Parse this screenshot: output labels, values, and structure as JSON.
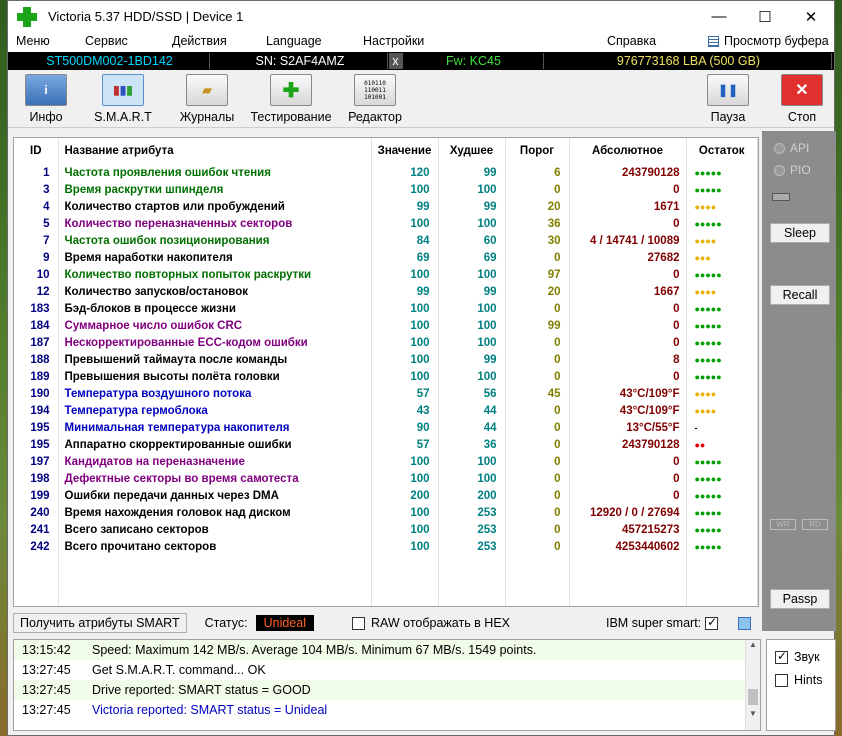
{
  "window": {
    "title": "Victoria 5.37 HDD/SSD | Device 1",
    "minimize": "—",
    "maximize": "☐",
    "close": "✕"
  },
  "menu": {
    "items": [
      "Меню",
      "Сервис",
      "Действия",
      "Language",
      "Настройки",
      "Справка"
    ],
    "buffer": "Просмотр буфера"
  },
  "info": {
    "model": "ST500DM002-1BD142",
    "sn": "SN: S2AF4AMZ",
    "x": "x",
    "fw": "Fw: KC45",
    "lba": "976773168 LBA (500 GB)"
  },
  "toolbar": {
    "info": "Инфо",
    "smart": "S.M.A.R.T",
    "logs": "Журналы",
    "test": "Тестирование",
    "editor": "Редактор",
    "pause": "Пауза",
    "stop": "Стоп"
  },
  "table": {
    "headers": {
      "id": "ID",
      "name": "Название атрибута",
      "value": "Значение",
      "worst": "Худшее",
      "threshold": "Порог",
      "absolute": "Абсолютное",
      "remaining": "Остаток"
    },
    "rows": [
      {
        "id": "1",
        "name": "Частота проявления ошибок чтения",
        "value": "120",
        "worst": "99",
        "thr": "6",
        "abs": "243790128",
        "rem": "●●●●●",
        "nc": "#007000",
        "rc": "#00a000"
      },
      {
        "id": "3",
        "name": "Время раскрутки шпинделя",
        "value": "100",
        "worst": "100",
        "thr": "0",
        "abs": "0",
        "rem": "●●●●●",
        "nc": "#007000",
        "rc": "#00a000"
      },
      {
        "id": "4",
        "name": "Количество стартов или пробуждений",
        "value": "99",
        "worst": "99",
        "thr": "20",
        "abs": "1671",
        "rem": "●●●●",
        "nc": "#000000",
        "rc": "#e8b000"
      },
      {
        "id": "5",
        "name": "Количество переназначенных секторов",
        "value": "100",
        "worst": "100",
        "thr": "36",
        "abs": "0",
        "rem": "●●●●●",
        "nc": "#800080",
        "rc": "#00a000"
      },
      {
        "id": "7",
        "name": "Частота ошибок позиционирования",
        "value": "84",
        "worst": "60",
        "thr": "30",
        "abs": "4 / 14741 / 10089",
        "rem": "●●●●",
        "nc": "#007000",
        "rc": "#e8b000"
      },
      {
        "id": "9",
        "name": "Время наработки накопителя",
        "value": "69",
        "worst": "69",
        "thr": "0",
        "abs": "27682",
        "rem": "●●●",
        "nc": "#000000",
        "rc": "#e8b000"
      },
      {
        "id": "10",
        "name": "Количество повторных попыток раскрутки",
        "value": "100",
        "worst": "100",
        "thr": "97",
        "abs": "0",
        "rem": "●●●●●",
        "nc": "#007000",
        "rc": "#00a000"
      },
      {
        "id": "12",
        "name": "Количество запусков/остановок",
        "value": "99",
        "worst": "99",
        "thr": "20",
        "abs": "1667",
        "rem": "●●●●",
        "nc": "#000000",
        "rc": "#e8b000"
      },
      {
        "id": "183",
        "name": "Бэд-блоков в процессе жизни",
        "value": "100",
        "worst": "100",
        "thr": "0",
        "abs": "0",
        "rem": "●●●●●",
        "nc": "#000000",
        "rc": "#00a000"
      },
      {
        "id": "184",
        "name": "Суммарное число ошибок CRC",
        "value": "100",
        "worst": "100",
        "thr": "99",
        "abs": "0",
        "rem": "●●●●●",
        "nc": "#800080",
        "rc": "#00a000"
      },
      {
        "id": "187",
        "name": "Нескорректированные ECC-кодом ошибки",
        "value": "100",
        "worst": "100",
        "thr": "0",
        "abs": "0",
        "rem": "●●●●●",
        "nc": "#800080",
        "rc": "#00a000"
      },
      {
        "id": "188",
        "name": "Превышений таймаута после команды",
        "value": "100",
        "worst": "99",
        "thr": "0",
        "abs": "8",
        "rem": "●●●●●",
        "nc": "#000000",
        "rc": "#00a000"
      },
      {
        "id": "189",
        "name": "Превышения высоты полёта головки",
        "value": "100",
        "worst": "100",
        "thr": "0",
        "abs": "0",
        "rem": "●●●●●",
        "nc": "#000000",
        "rc": "#00a000"
      },
      {
        "id": "190",
        "name": "Температура воздушного потока",
        "value": "57",
        "worst": "56",
        "thr": "45",
        "abs": "43°C/109°F",
        "rem": "●●●●",
        "nc": "#0000c0",
        "rc": "#e8b000"
      },
      {
        "id": "194",
        "name": "Температура гермоблока",
        "value": "43",
        "worst": "44",
        "thr": "0",
        "abs": "43°C/109°F",
        "rem": "●●●●",
        "nc": "#0000c0",
        "rc": "#e8b000"
      },
      {
        "id": "195",
        "name": "Минимальная температура накопителя",
        "value": "90",
        "worst": "44",
        "thr": "0",
        "abs": "13°C/55°F",
        "rem": "-",
        "nc": "#0000c0",
        "rc": "#000000"
      },
      {
        "id": "195",
        "name": "Аппаратно скорректированные ошибки",
        "value": "57",
        "worst": "36",
        "thr": "0",
        "abs": "243790128",
        "rem": "●●",
        "nc": "#000000",
        "rc": "#e00000"
      },
      {
        "id": "197",
        "name": "Кандидатов на переназначение",
        "value": "100",
        "worst": "100",
        "thr": "0",
        "abs": "0",
        "rem": "●●●●●",
        "nc": "#800080",
        "rc": "#00a000"
      },
      {
        "id": "198",
        "name": "Дефектные секторы во время самотеста",
        "value": "100",
        "worst": "100",
        "thr": "0",
        "abs": "0",
        "rem": "●●●●●",
        "nc": "#800080",
        "rc": "#00a000"
      },
      {
        "id": "199",
        "name": "Ошибки передачи данных через DMA",
        "value": "200",
        "worst": "200",
        "thr": "0",
        "abs": "0",
        "rem": "●●●●●",
        "nc": "#000000",
        "rc": "#00a000"
      },
      {
        "id": "240",
        "name": "Время нахождения головок над диском",
        "value": "100",
        "worst": "253",
        "thr": "0",
        "abs": "12920 / 0 / 27694",
        "rem": "●●●●●",
        "nc": "#000000",
        "rc": "#00a000"
      },
      {
        "id": "241",
        "name": "Всего записано секторов",
        "value": "100",
        "worst": "253",
        "thr": "0",
        "abs": "457215273",
        "rem": "●●●●●",
        "nc": "#000000",
        "rc": "#00a000"
      },
      {
        "id": "242",
        "name": "Всего прочитано секторов",
        "value": "100",
        "worst": "253",
        "thr": "0",
        "abs": "4253440602",
        "rem": "●●●●●",
        "nc": "#000000",
        "rc": "#00a000"
      }
    ]
  },
  "side": {
    "api": "API",
    "pio": "PIO",
    "sleep": "Sleep",
    "recall": "Recall",
    "passp": "Passp",
    "wr": "WR",
    "rd": "RD"
  },
  "status": {
    "get_smart": "Получить атрибуты SMART",
    "label": "Статус:",
    "value": "Unideal",
    "raw_hex": "RAW отображать в HEX",
    "ibm": "IBM super smart:"
  },
  "log": [
    {
      "time": "13:15:42",
      "text": "Speed: Maximum 142 MB/s. Average 104 MB/s. Minimum 67 MB/s. 1549 points.",
      "color": "#000000"
    },
    {
      "time": "13:27:45",
      "text": "Get S.M.A.R.T. command... OK",
      "color": "#000000"
    },
    {
      "time": "13:27:45",
      "text": "Drive reported: SMART status = GOOD",
      "color": "#000000"
    },
    {
      "time": "13:27:45",
      "text": "Victoria reported: SMART status = Unideal",
      "color": "#0000c0"
    }
  ],
  "options": {
    "sound": "Звук",
    "hints": "Hints"
  }
}
